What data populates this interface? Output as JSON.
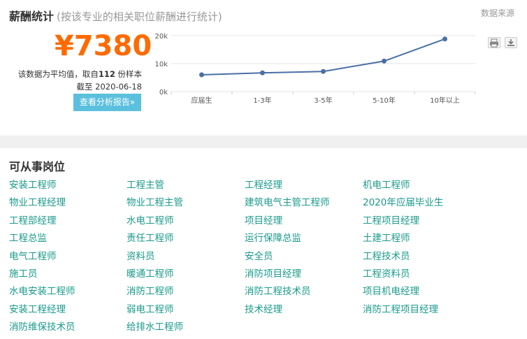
{
  "salary": {
    "title": "薪酬统计",
    "subtitle": "(按该专业的相关职位薪酬进行统计)",
    "source_label": "数据来源",
    "price": "¥7380",
    "note_prefix": "该数据为平均值，取自",
    "sample_count": "112",
    "note_suffix": "份样本",
    "date_text": "截至 2020-06-18",
    "report_button": "查看分析报告»",
    "chart_tools": [
      "print-icon",
      "download-icon"
    ]
  },
  "chart_data": {
    "type": "line",
    "categories": [
      "应届生",
      "1-3年",
      "3-5年",
      "5-10年",
      "10年以上"
    ],
    "values": [
      6000,
      6700,
      7200,
      10900,
      18800
    ],
    "y_ticks": [
      "0k",
      "10k",
      "20k"
    ],
    "ylim": [
      0,
      20000
    ],
    "grid": true,
    "line_color": "#4a6fa5"
  },
  "jobs": {
    "title": "可从事岗位",
    "columns": [
      [
        "安装工程师",
        "物业工程经理",
        "工程部经理",
        "工程总监",
        "电气工程师",
        "施工员",
        "水电安装工程师",
        "安装工程经理",
        "消防维保技术员"
      ],
      [
        "工程主管",
        "物业工程主管",
        "水电工程师",
        "责任工程师",
        "资料员",
        "暖通工程师",
        "消防工程师",
        "弱电工程师",
        "给排水工程师"
      ],
      [
        "工程经理",
        "建筑电气主管工程师",
        "项目经理",
        "运行保障总监",
        "安全员",
        "消防项目经理",
        "消防工程技术员",
        "技术经理"
      ],
      [
        "机电工程师",
        "2020年应届毕业生",
        "工程项目经理",
        "土建工程师",
        "工程技术员",
        "工程资料员",
        "项目机电经理",
        "消防工程项目经理"
      ]
    ],
    "link_color": "#1a9a8a"
  }
}
